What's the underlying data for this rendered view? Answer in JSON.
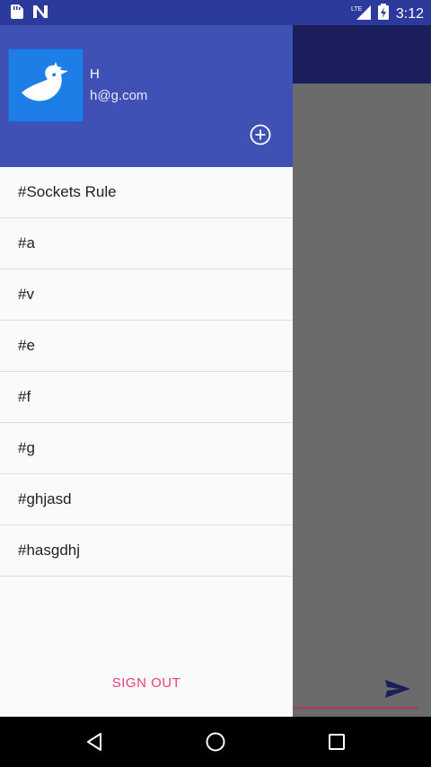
{
  "status_bar": {
    "time": "3:12",
    "network": "LTE",
    "icons": [
      "sd-card-icon",
      "notification-n-icon",
      "signal-icon",
      "battery-icon"
    ]
  },
  "drawer": {
    "user_name": "H",
    "user_email": "h@g.com",
    "channels": [
      "#Sockets Rule",
      "#a",
      "#v",
      "#e",
      "#f",
      "#g",
      "#ghjasd",
      "#hasgdhj"
    ],
    "sign_out_label": "SIGN OUT"
  },
  "colors": {
    "header": "#3f51b5",
    "appbar": "#1a1f5c",
    "accent": "#e83e78"
  }
}
